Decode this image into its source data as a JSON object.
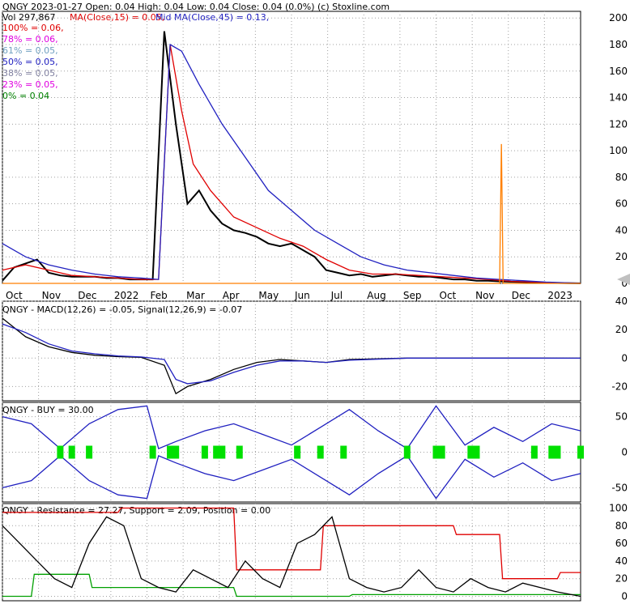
{
  "header": {
    "line1": "QNGY  2023-01-27 Open: 0.04  High: 0.04  Low: 0.04  Close: 0.04 (0.0%)  (c) Stoxline.com",
    "vol": "Vol 297,867",
    "ma15": "MA(Close,15) = 0.05,",
    "ma45": "Mid MA(Close,45) = 0.13,"
  },
  "fib_levels": [
    {
      "label": "100% = 0.06,",
      "color": "#e00000"
    },
    {
      "label": "78% = 0.06,",
      "color": "#e000e0"
    },
    {
      "label": "61% = 0.05,",
      "color": "#70a0c0"
    },
    {
      "label": "50% = 0.05,",
      "color": "#2020c0"
    },
    {
      "label": "38% = 0.05,",
      "color": "#8080a0"
    },
    {
      "label": "23% = 0.05,",
      "color": "#e000e0"
    },
    {
      "label": "0% = 0.04",
      "color": "#008000"
    }
  ],
  "colors": {
    "price": "#000000",
    "ma_short": "#e00000",
    "ma_mid": "#2020c0",
    "support": "#00a000",
    "resistance": "#e00000",
    "volume": "#ff7f00",
    "buy_signal": "#00e000",
    "grid": "#a0a0a0"
  },
  "chart_data": [
    {
      "name": "price-panel",
      "type": "line",
      "x_tick_labels": [
        "Oct",
        "Nov",
        "Dec",
        "2022",
        "Feb",
        "Mar",
        "Apr",
        "May",
        "Jun",
        "Jul",
        "Aug",
        "Sep",
        "Oct",
        "Nov",
        "Dec",
        "2023"
      ],
      "y_ticks": [
        0,
        20,
        40,
        60,
        80,
        100,
        120,
        140,
        160,
        180,
        200
      ],
      "ylim": [
        0,
        205
      ],
      "grid": true,
      "series": [
        {
          "key": "price",
          "x": [
            0,
            2,
            4,
            6,
            8,
            10,
            12,
            14,
            16,
            18,
            20,
            22,
            24,
            26,
            28,
            30,
            32,
            34,
            36,
            38,
            40,
            42,
            44,
            46,
            48,
            50,
            52,
            54,
            56,
            58,
            60,
            62,
            64,
            66,
            68,
            70,
            72,
            74,
            76,
            78,
            80,
            82,
            84,
            86,
            88,
            90,
            92,
            94,
            96,
            98,
            100
          ],
          "y": [
            2,
            12,
            15,
            18,
            8,
            6,
            5,
            5,
            5,
            4,
            4,
            3,
            3,
            3,
            190,
            120,
            60,
            70,
            55,
            45,
            40,
            38,
            35,
            30,
            28,
            30,
            25,
            20,
            10,
            8,
            6,
            7,
            5,
            6,
            7,
            6,
            5,
            5,
            4,
            3,
            3,
            2,
            2,
            1.5,
            1.2,
            1,
            0.8,
            0.5,
            0.3,
            0.1,
            0.04
          ]
        },
        {
          "key": "ma15",
          "x": [
            0,
            4,
            8,
            12,
            16,
            20,
            24,
            27,
            29,
            31,
            33,
            36,
            40,
            44,
            48,
            52,
            56,
            60,
            64,
            68,
            72,
            76,
            80,
            84,
            88,
            92,
            96,
            100
          ],
          "y": [
            10,
            14,
            10,
            6,
            5,
            4,
            3,
            3,
            180,
            130,
            90,
            70,
            50,
            42,
            34,
            28,
            18,
            10,
            7,
            7,
            6,
            5,
            4,
            3,
            1.5,
            1,
            0.4,
            0.05
          ]
        },
        {
          "key": "ma45",
          "x": [
            0,
            4,
            8,
            12,
            16,
            20,
            24,
            27,
            29,
            31,
            34,
            38,
            42,
            46,
            50,
            54,
            58,
            62,
            66,
            70,
            74,
            78,
            82,
            86,
            90,
            94,
            100
          ],
          "y": [
            30,
            20,
            14,
            10,
            7,
            5,
            4,
            3,
            180,
            175,
            150,
            120,
            95,
            70,
            55,
            40,
            30,
            20,
            14,
            10,
            8,
            6,
            4,
            3,
            2,
            1,
            0.13
          ]
        },
        {
          "key": "volume",
          "x": [
            0,
            86,
            86.3,
            86.6,
            100
          ],
          "y": [
            0,
            0,
            105,
            0,
            0
          ]
        }
      ]
    },
    {
      "name": "macd-panel",
      "type": "line",
      "title": "QNGY - MACD(12,26) = -0.05, Signal(12,26,9) = -0.07",
      "y_ticks": [
        40,
        20,
        0,
        -20
      ],
      "ylim": [
        -30,
        40
      ],
      "grid": true,
      "series": [
        {
          "key": "macd",
          "x": [
            0,
            4,
            8,
            12,
            16,
            20,
            24,
            28,
            30,
            32,
            36,
            40,
            44,
            48,
            52,
            56,
            60,
            70,
            80,
            90,
            100
          ],
          "y": [
            28,
            15,
            8,
            4,
            2,
            1,
            0.5,
            -5,
            -25,
            -20,
            -15,
            -8,
            -3,
            -1,
            -2,
            -3,
            -1,
            0,
            0,
            0,
            -0.05
          ]
        },
        {
          "key": "signal",
          "x": [
            0,
            4,
            8,
            12,
            16,
            20,
            24,
            28,
            30,
            32,
            36,
            40,
            44,
            48,
            52,
            56,
            60,
            70,
            80,
            90,
            100
          ],
          "y": [
            24,
            18,
            10,
            5,
            3,
            1.5,
            0.8,
            -1,
            -15,
            -18,
            -16,
            -10,
            -5,
            -2,
            -2,
            -3,
            -1.5,
            0,
            0,
            0,
            -0.07
          ]
        }
      ]
    },
    {
      "name": "buy-panel",
      "type": "line",
      "title": "QNGY - BUY = 30.00",
      "y_ticks": [
        50,
        0,
        -50
      ],
      "ylim": [
        -70,
        70
      ],
      "grid": true,
      "series": [
        {
          "key": "band_upper",
          "x": [
            0,
            5,
            10,
            15,
            20,
            25,
            27,
            30,
            35,
            40,
            45,
            50,
            55,
            60,
            65,
            70,
            75,
            80,
            85,
            90,
            95,
            100
          ],
          "y": [
            50,
            40,
            5,
            40,
            60,
            65,
            5,
            15,
            30,
            40,
            25,
            10,
            35,
            60,
            30,
            5,
            65,
            10,
            35,
            15,
            40,
            30
          ]
        },
        {
          "key": "band_lower",
          "x": [
            0,
            5,
            10,
            15,
            20,
            25,
            27,
            30,
            35,
            40,
            45,
            50,
            55,
            60,
            65,
            70,
            75,
            80,
            85,
            90,
            95,
            100
          ],
          "y": [
            -50,
            -40,
            -5,
            -40,
            -60,
            -65,
            -5,
            -15,
            -30,
            -40,
            -25,
            -10,
            -35,
            -60,
            -30,
            -5,
            -65,
            -10,
            -35,
            -15,
            -40,
            -30
          ]
        }
      ],
      "buy_markers_x": [
        10,
        12,
        15,
        26,
        29,
        30,
        35,
        37,
        38,
        41,
        51,
        55,
        59,
        70,
        75,
        76,
        81,
        82,
        92,
        95,
        96,
        100
      ]
    },
    {
      "name": "position-panel",
      "type": "line",
      "title": "QNGY - Resistance = 27.27, Support = 2.09, Position = 0.00",
      "y_ticks": [
        100,
        80,
        60,
        40,
        20,
        0
      ],
      "ylim": [
        -5,
        105
      ],
      "grid": true,
      "series": [
        {
          "key": "resistance",
          "x": [
            0,
            20,
            20.5,
            40,
            40.5,
            55,
            55.5,
            78,
            78.5,
            86,
            86.5,
            96,
            96.5,
            100
          ],
          "y": [
            95,
            95,
            100,
            100,
            30,
            30,
            80,
            80,
            70,
            70,
            20,
            20,
            27,
            27
          ]
        },
        {
          "key": "support",
          "x": [
            0,
            5,
            5.5,
            15,
            15.5,
            40,
            40.5,
            60,
            60.5,
            100
          ],
          "y": [
            0,
            0,
            25,
            25,
            10,
            10,
            0,
            0,
            2,
            2
          ]
        },
        {
          "key": "position",
          "x": [
            0,
            3,
            6,
            9,
            12,
            15,
            18,
            21,
            24,
            27,
            30,
            33,
            36,
            39,
            42,
            45,
            48,
            51,
            54,
            57,
            60,
            63,
            66,
            69,
            72,
            75,
            78,
            81,
            84,
            87,
            90,
            93,
            96,
            100
          ],
          "y": [
            80,
            60,
            40,
            20,
            10,
            60,
            90,
            80,
            20,
            10,
            5,
            30,
            20,
            10,
            40,
            20,
            10,
            60,
            70,
            90,
            20,
            10,
            5,
            10,
            30,
            10,
            5,
            20,
            10,
            5,
            15,
            10,
            5,
            0
          ]
        }
      ]
    }
  ]
}
